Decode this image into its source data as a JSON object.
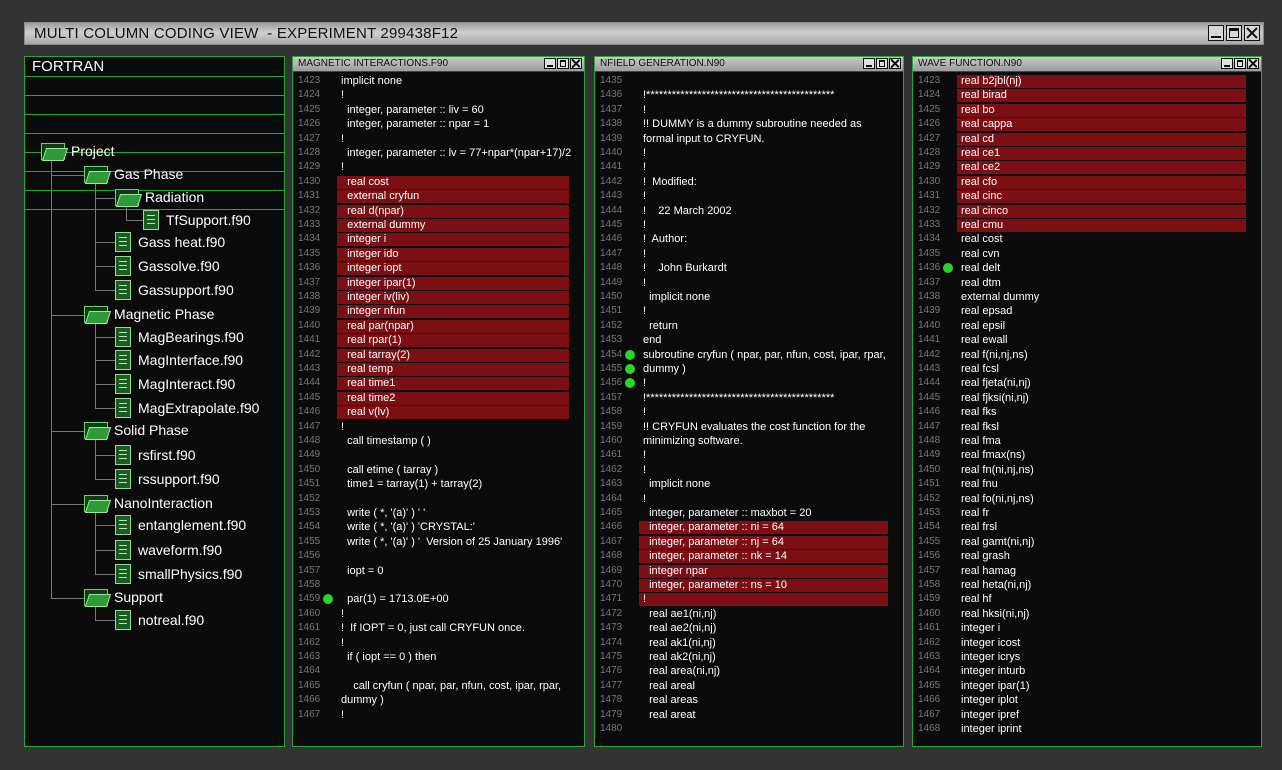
{
  "window": {
    "title": "MULTI COLUMN CODING VIEW  - EXPERIMENT 299438F12"
  },
  "sidebar": {
    "header": "FORTRAN",
    "tree": [
      {
        "label": "Project",
        "type": "folder",
        "depth": 0
      },
      {
        "label": "Gas Phase",
        "type": "folder",
        "depth": 1
      },
      {
        "label": "Radiation",
        "type": "folder",
        "depth": 2
      },
      {
        "label": "TfSupport.f90",
        "type": "file",
        "depth": 3
      },
      {
        "label": "Gass heat.f90",
        "type": "file",
        "depth": 2
      },
      {
        "label": "Gassolve.f90",
        "type": "file",
        "depth": 2
      },
      {
        "label": "Gassupport.f90",
        "type": "file",
        "depth": 2
      },
      {
        "label": "Magnetic Phase",
        "type": "folder",
        "depth": 1
      },
      {
        "label": "MagBearings.f90",
        "type": "file",
        "depth": 2
      },
      {
        "label": "MagInterface.f90",
        "type": "file",
        "depth": 2
      },
      {
        "label": "MagInteract.f90",
        "type": "file",
        "depth": 2
      },
      {
        "label": "MagExtrapolate.f90",
        "type": "file",
        "depth": 2
      },
      {
        "label": "Solid Phase",
        "type": "folder",
        "depth": 1
      },
      {
        "label": "rsfirst.f90",
        "type": "file",
        "depth": 2
      },
      {
        "label": "rssupport.f90",
        "type": "file",
        "depth": 2
      },
      {
        "label": "NanoInteraction",
        "type": "folder",
        "depth": 1
      },
      {
        "label": "entanglement.f90",
        "type": "file",
        "depth": 2
      },
      {
        "label": "waveform.f90",
        "type": "file",
        "depth": 2
      },
      {
        "label": "smallPhysics.f90",
        "type": "file",
        "depth": 2
      },
      {
        "label": "Support",
        "type": "folder",
        "depth": 1
      },
      {
        "label": "notreal.f90",
        "type": "file",
        "depth": 2
      }
    ]
  },
  "panels": [
    {
      "title": "MAGNETIC INTERACTIONS.F90",
      "lines": [
        {
          "n": "1423",
          "text": "implicit none"
        },
        {
          "n": "1424",
          "text": "!"
        },
        {
          "n": "1425",
          "text": "  integer, parameter :: liv = 60"
        },
        {
          "n": "1426",
          "text": "  integer, parameter :: npar = 1"
        },
        {
          "n": "1427",
          "text": "!"
        },
        {
          "n": "1428",
          "text": "  integer, parameter :: lv = 77+npar*(npar+17)/2"
        },
        {
          "n": "1429",
          "text": "!"
        },
        {
          "n": "1430",
          "text": "  real cost",
          "hl": true
        },
        {
          "n": "1431",
          "text": "  external cryfun",
          "hl": true
        },
        {
          "n": "1432",
          "text": "  real d(npar)",
          "hl": true
        },
        {
          "n": "1433",
          "text": "  external dummy",
          "hl": true
        },
        {
          "n": "1434",
          "text": "  integer i",
          "hl": true
        },
        {
          "n": "1435",
          "text": "  integer ido",
          "hl": true
        },
        {
          "n": "1436",
          "text": "  integer iopt",
          "hl": true
        },
        {
          "n": "1437",
          "text": "  integer ipar(1)",
          "hl": true
        },
        {
          "n": "1438",
          "text": "  integer iv(liv)",
          "hl": true
        },
        {
          "n": "1439",
          "text": "  integer nfun",
          "hl": true
        },
        {
          "n": "1440",
          "text": "  real par(npar)",
          "hl": true
        },
        {
          "n": "1441",
          "text": "  real rpar(1)",
          "hl": true
        },
        {
          "n": "1442",
          "text": "  real tarray(2)",
          "hl": true
        },
        {
          "n": "1443",
          "text": "  real temp",
          "hl": true
        },
        {
          "n": "1444",
          "text": "  real time1",
          "hl": true
        },
        {
          "n": "1445",
          "text": "  real time2",
          "hl": true
        },
        {
          "n": "1446",
          "text": "  real v(lv)",
          "hl": true
        },
        {
          "n": "1447",
          "text": "!"
        },
        {
          "n": "1448",
          "text": "  call timestamp ( )"
        },
        {
          "n": "1449",
          "text": ""
        },
        {
          "n": "1450",
          "text": "  call etime ( tarray )"
        },
        {
          "n": "1451",
          "text": "  time1 = tarray(1) + tarray(2)"
        },
        {
          "n": "1452",
          "text": ""
        },
        {
          "n": "1453",
          "text": "  write ( *, '(a)' ) ' '"
        },
        {
          "n": "1454",
          "text": "  write ( *, '(a)' ) 'CRYSTAL:'"
        },
        {
          "n": "1455",
          "text": "  write ( *, '(a)' ) '  Version of 25 January 1996'"
        },
        {
          "n": "1456",
          "text": ""
        },
        {
          "n": "1457",
          "text": "  iopt = 0"
        },
        {
          "n": "1458",
          "text": ""
        },
        {
          "n": "1459",
          "text": "  par(1) = 1713.0E+00",
          "dot": true
        },
        {
          "n": "1460",
          "text": "!"
        },
        {
          "n": "1461",
          "text": "!  If IOPT = 0, just call CRYFUN once."
        },
        {
          "n": "1462",
          "text": "!"
        },
        {
          "n": "1463",
          "text": "  if ( iopt == 0 ) then"
        },
        {
          "n": "1464",
          "text": ""
        },
        {
          "n": "1465",
          "text": "    call cryfun ( npar, par, nfun, cost, ipar, rpar,"
        },
        {
          "n": "1466",
          "text": "dummy )"
        },
        {
          "n": "1467",
          "text": "!"
        }
      ]
    },
    {
      "title": "NFIELD GENERATION.N90",
      "lines": [
        {
          "n": "1435",
          "text": ""
        },
        {
          "n": "1436",
          "text": "!********************************************"
        },
        {
          "n": "1437",
          "text": "!"
        },
        {
          "n": "1438",
          "text": "!! DUMMY is a dummy subroutine needed as"
        },
        {
          "n": "1439",
          "text": "formal input to CRYFUN."
        },
        {
          "n": "1440",
          "text": "!"
        },
        {
          "n": "1441",
          "text": "!"
        },
        {
          "n": "1442",
          "text": "!  Modified:"
        },
        {
          "n": "1443",
          "text": "!"
        },
        {
          "n": "1444",
          "text": "!    22 March 2002"
        },
        {
          "n": "1445",
          "text": "!"
        },
        {
          "n": "1446",
          "text": "!  Author:"
        },
        {
          "n": "1447",
          "text": "!"
        },
        {
          "n": "1448",
          "text": "!    John Burkardt"
        },
        {
          "n": "1449",
          "text": "!"
        },
        {
          "n": "1450",
          "text": "  implicit none"
        },
        {
          "n": "1451",
          "text": "!"
        },
        {
          "n": "1452",
          "text": "  return"
        },
        {
          "n": "1453",
          "text": "end"
        },
        {
          "n": "1454",
          "text": "subroutine cryfun ( npar, par, nfun, cost, ipar, rpar,",
          "dot": true
        },
        {
          "n": "1455",
          "text": "dummy )",
          "dot": true
        },
        {
          "n": "1456",
          "text": "!",
          "dot": true
        },
        {
          "n": "1457",
          "text": "!********************************************"
        },
        {
          "n": "1458",
          "text": "!"
        },
        {
          "n": "1459",
          "text": "!! CRYFUN evaluates the cost function for the"
        },
        {
          "n": "1460",
          "text": "minimizing software."
        },
        {
          "n": "1461",
          "text": "!"
        },
        {
          "n": "1462",
          "text": "!"
        },
        {
          "n": "1463",
          "text": "  implicit none"
        },
        {
          "n": "1464",
          "text": "!"
        },
        {
          "n": "1465",
          "text": "  integer, parameter :: maxbot = 20"
        },
        {
          "n": "1466",
          "text": "  integer, parameter :: ni = 64",
          "hl": true
        },
        {
          "n": "1467",
          "text": "  integer, parameter :: nj = 64",
          "hl": true
        },
        {
          "n": "1468",
          "text": "  integer, parameter :: nk = 14",
          "hl": true
        },
        {
          "n": "1469",
          "text": "  integer npar",
          "hl": true
        },
        {
          "n": "1470",
          "text": "  integer, parameter :: ns = 10",
          "hl": true
        },
        {
          "n": "1471",
          "text": "!",
          "hl": true
        },
        {
          "n": "1472",
          "text": "  real ae1(ni,nj)"
        },
        {
          "n": "1473",
          "text": "  real ae2(ni,nj)"
        },
        {
          "n": "1474",
          "text": "  real ak1(ni,nj)"
        },
        {
          "n": "1475",
          "text": "  real ak2(ni,nj)"
        },
        {
          "n": "1476",
          "text": "  real area(ni,nj)"
        },
        {
          "n": "1477",
          "text": "  real areal"
        },
        {
          "n": "1478",
          "text": "  real areas"
        },
        {
          "n": "1479",
          "text": "  real areat"
        },
        {
          "n": "1480",
          "text": ""
        }
      ]
    },
    {
      "title": "WAVE FUNCTION.N90",
      "lines": [
        {
          "n": "1423",
          "text": "real b2jbl(nj)",
          "hl": true
        },
        {
          "n": "1424",
          "text": "real birad",
          "hl": true
        },
        {
          "n": "1425",
          "text": "real bo",
          "hl": true
        },
        {
          "n": "1426",
          "text": "real cappa",
          "hl": true
        },
        {
          "n": "1427",
          "text": "real cd",
          "hl": true
        },
        {
          "n": "1428",
          "text": "real ce1",
          "hl": true
        },
        {
          "n": "1429",
          "text": "real ce2",
          "hl": true
        },
        {
          "n": "1430",
          "text": "real cfo",
          "hl": true
        },
        {
          "n": "1431",
          "text": "real cinc",
          "hl": true
        },
        {
          "n": "1432",
          "text": "real cinco",
          "hl": true
        },
        {
          "n": "1433",
          "text": "real cmu",
          "hl": true
        },
        {
          "n": "1434",
          "text": "real cost"
        },
        {
          "n": "1435",
          "text": "real cvn"
        },
        {
          "n": "1436",
          "text": "real delt",
          "dot": true
        },
        {
          "n": "1437",
          "text": "real dtm"
        },
        {
          "n": "1438",
          "text": "external dummy"
        },
        {
          "n": "1439",
          "text": "real epsad"
        },
        {
          "n": "1440",
          "text": "real epsil"
        },
        {
          "n": "1441",
          "text": "real ewall"
        },
        {
          "n": "1442",
          "text": "real f(ni,nj,ns)"
        },
        {
          "n": "1443",
          "text": "real fcsl"
        },
        {
          "n": "1444",
          "text": "real fjeta(ni,nj)"
        },
        {
          "n": "1445",
          "text": "real fjksi(ni,nj)"
        },
        {
          "n": "1446",
          "text": "real fks"
        },
        {
          "n": "1447",
          "text": "real fksl"
        },
        {
          "n": "1448",
          "text": "real fma"
        },
        {
          "n": "1449",
          "text": "real fmax(ns)"
        },
        {
          "n": "1450",
          "text": "real fn(ni,nj,ns)"
        },
        {
          "n": "1451",
          "text": "real fnu"
        },
        {
          "n": "1452",
          "text": "real fo(ni,nj,ns)"
        },
        {
          "n": "1453",
          "text": "real fr"
        },
        {
          "n": "1454",
          "text": "real frsl"
        },
        {
          "n": "1455",
          "text": "real gamt(ni,nj)"
        },
        {
          "n": "1456",
          "text": "real grash"
        },
        {
          "n": "1457",
          "text": "real hamag"
        },
        {
          "n": "1458",
          "text": "real heta(ni,nj)"
        },
        {
          "n": "1459",
          "text": "real hf"
        },
        {
          "n": "1460",
          "text": "real hksi(ni,nj)"
        },
        {
          "n": "1461",
          "text": "integer i"
        },
        {
          "n": "1462",
          "text": "integer icost"
        },
        {
          "n": "1463",
          "text": "integer icrys"
        },
        {
          "n": "1464",
          "text": "integer inturb"
        },
        {
          "n": "1465",
          "text": "integer ipar(1)"
        },
        {
          "n": "1466",
          "text": "integer iplot"
        },
        {
          "n": "1467",
          "text": "integer ipref"
        },
        {
          "n": "1468",
          "text": "integer iprint"
        }
      ]
    }
  ]
}
